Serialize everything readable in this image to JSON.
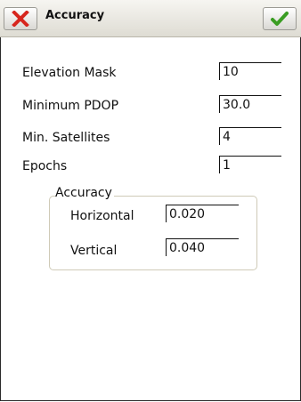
{
  "titlebar": {
    "title": "Accuracy",
    "close_icon": "close-x-icon",
    "ok_icon": "checkmark-icon",
    "close_color": "#d7261e",
    "ok_color": "#3a9d23"
  },
  "form": {
    "elevation_mask": {
      "label": "Elevation Mask",
      "value": "10"
    },
    "minimum_pdop": {
      "label": "Minimum PDOP",
      "value": "30.0"
    },
    "min_satellites": {
      "label": "Min. Satellites",
      "value": "4"
    },
    "epochs": {
      "label": "Epochs",
      "value": "1"
    }
  },
  "accuracy_group": {
    "legend": "Accuracy",
    "horizontal": {
      "label": "Horizontal",
      "value": "0.020"
    },
    "vertical": {
      "label": "Vertical",
      "value": "0.040"
    }
  }
}
